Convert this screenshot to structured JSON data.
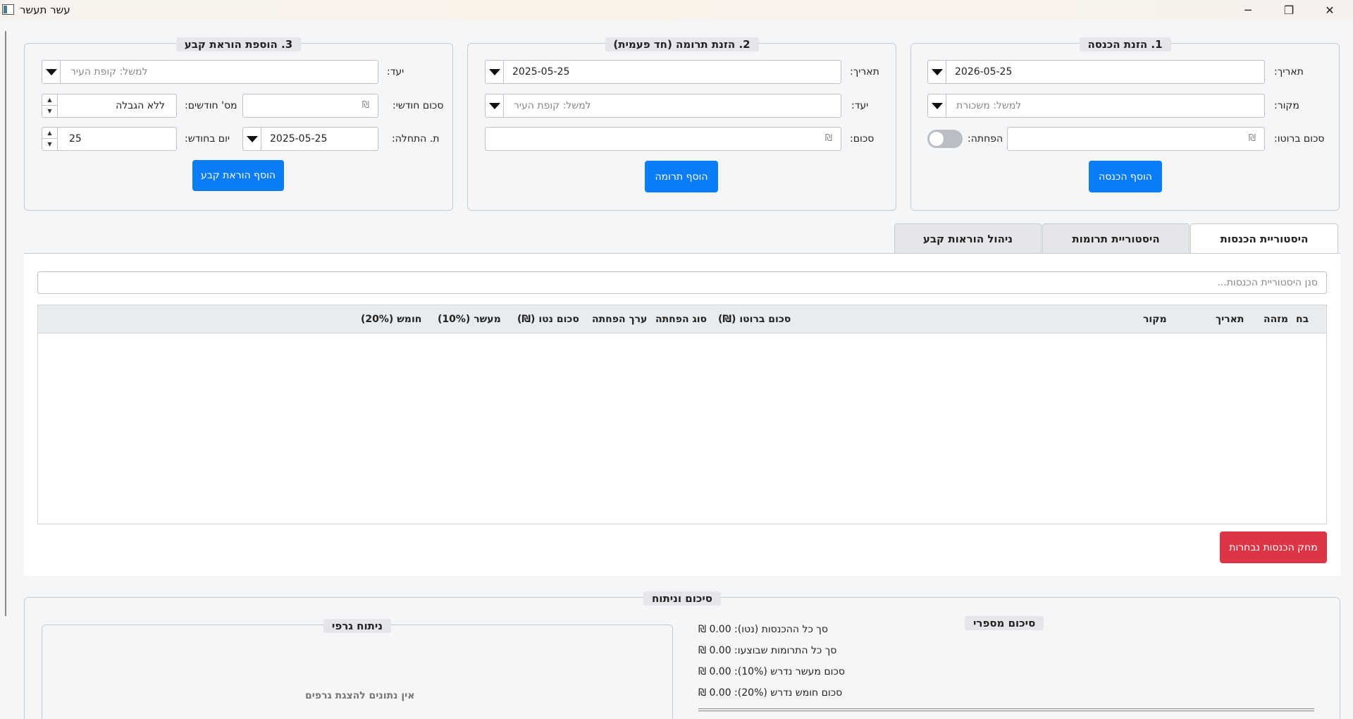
{
  "window": {
    "title": "עשר תעשר",
    "minimize": "─",
    "maximize": "❐",
    "close": "✕"
  },
  "income_form": {
    "title": "1. הזנת הכנסה",
    "date_label": "תאריך:",
    "date_value": "2026-05-25",
    "source_label": "מקור:",
    "source_placeholder": "למשל: משכורת",
    "gross_label": "סכום ברוטו:",
    "gross_currency": "₪",
    "deduction_label": "הפחתה:",
    "deduction_enabled": false,
    "submit_label": "הוסף הכנסה"
  },
  "donation_form": {
    "title": "2. הזנת תרומה (חד פעמית)",
    "date_label": "תאריך:",
    "date_value": "2025-05-25",
    "target_label": "יעד:",
    "target_placeholder": "למשל: קופת העיר",
    "amount_label": "סכום:",
    "amount_currency": "₪",
    "submit_label": "הוסף תרומה"
  },
  "standing_order_form": {
    "title": "3. הוספת הוראת קבע",
    "target_label": "יעד:",
    "target_placeholder": "למשל: קופת העיר",
    "monthly_amount_label": "סכום חודשי:",
    "monthly_amount_currency": "₪",
    "months_label": "מס' חודשים:",
    "months_value": "ללא הגבלה",
    "start_label": "ת. התחלה:",
    "start_value": "2025-05-25",
    "day_label": "יום בחודש:",
    "day_value": "25",
    "submit_label": "הוסף הוראת קבע"
  },
  "tabs": [
    {
      "label": "היסטוריית הכנסות",
      "active": true
    },
    {
      "label": "היסטוריית תרומות",
      "active": false
    },
    {
      "label": "ניהול הוראות קבע",
      "active": false
    }
  ],
  "income_history": {
    "search_placeholder": "סנן היסטוריית הכנסות...",
    "columns": [
      "בח",
      "מזהה",
      "תאריך",
      "מקור",
      "סכום ברוטו (₪)",
      "סוג הפחתה",
      "ערך הפחתה",
      "סכום נטו (₪)",
      "מעשר (10%)",
      "חומש (20%)"
    ],
    "rows": [],
    "delete_label": "מחק הכנסות נבחרות"
  },
  "summary": {
    "title": "סיכום וניתוח",
    "numeric_title": "סיכום מספרי",
    "lines": [
      "סך כל ההכנסות (נטו): 0.00 ₪",
      "סך כל התרומות שבוצעו: 0.00 ₪",
      "סכום מעשר נדרש (10%): 0.00 ₪",
      "סכום חומש נדרש (20%): 0.00 ₪"
    ],
    "graph_title": "ניתוח גרפי",
    "no_data": "אין נתונים להצגת גרפים"
  },
  "colors": {
    "primary": "#0a7cf5",
    "danger": "#dc3545",
    "background": "#f5f6f7"
  }
}
